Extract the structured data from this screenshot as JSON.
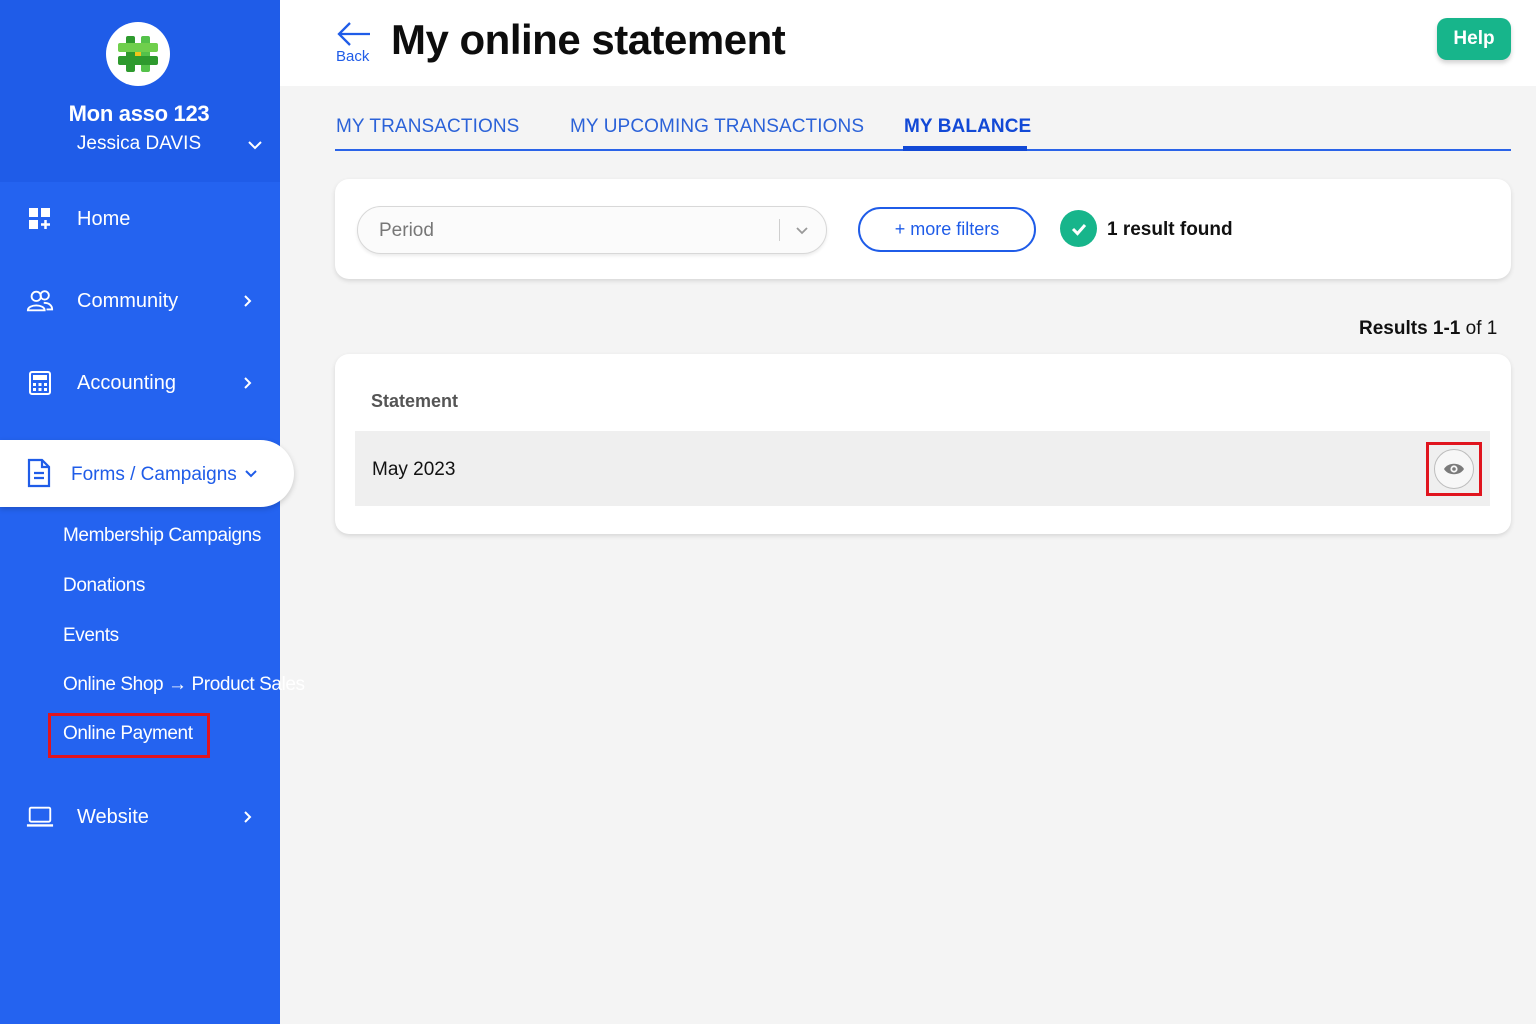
{
  "sidebar": {
    "org_name": "Mon asso 123",
    "user_name": "Jessica DAVIS",
    "nav": {
      "home": "Home",
      "community": "Community",
      "accounting": "Accounting",
      "forms": "Forms / Campaigns",
      "website": "Website"
    },
    "sub_items": {
      "membership": "Membership Campaigns",
      "donations": "Donations",
      "events": "Events",
      "shop": "Online Shop → Product Sales",
      "payment": "Online Payment"
    }
  },
  "header": {
    "back_label": "Back",
    "title": "My online statement",
    "help_label": "Help"
  },
  "tabs": {
    "transactions": "MY TRANSACTIONS",
    "upcoming": "MY UPCOMING TRANSACTIONS",
    "balance": "MY BALANCE"
  },
  "filters": {
    "period_placeholder": "Period",
    "more_filters": "+ more filters",
    "result_found": "1 result found"
  },
  "results": {
    "label": "Results 1-1",
    "of_label": "of 1"
  },
  "table": {
    "column": "Statement",
    "rows": [
      "May 2023"
    ]
  },
  "colors": {
    "sidebar": "#2463f0",
    "accent": "#1f5ce8",
    "success": "#17b58b",
    "highlight": "#e0141e"
  }
}
